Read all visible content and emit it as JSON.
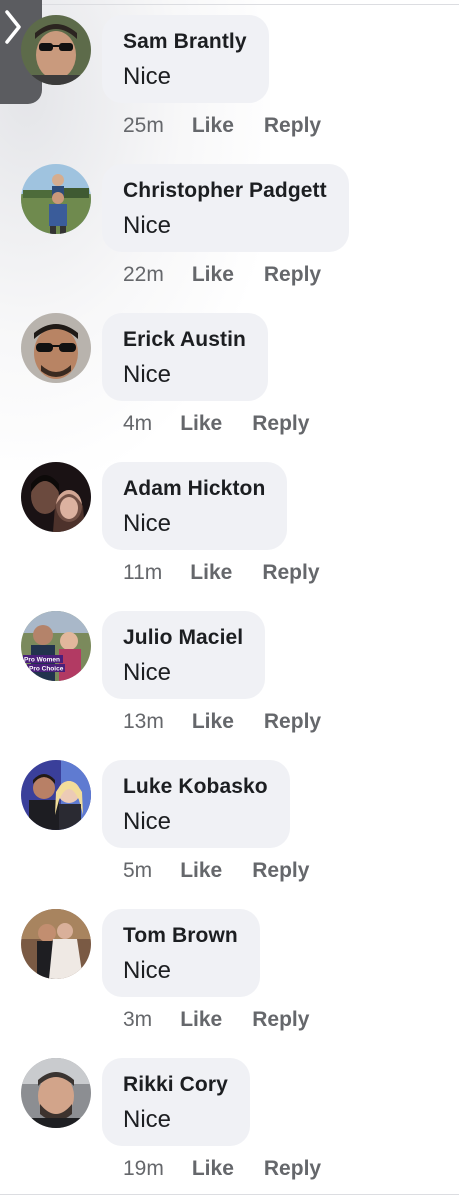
{
  "comments": [
    {
      "author": "Sam Brantly",
      "text": "Nice",
      "time": "25m",
      "like_label": "Like",
      "reply_label": "Reply"
    },
    {
      "author": "Christopher Padgett",
      "text": "Nice",
      "time": "22m",
      "like_label": "Like",
      "reply_label": "Reply"
    },
    {
      "author": "Erick Austin",
      "text": "Nice",
      "time": "4m",
      "like_label": "Like",
      "reply_label": "Reply"
    },
    {
      "author": "Adam Hickton",
      "text": "Nice",
      "time": "11m",
      "like_label": "Like",
      "reply_label": "Reply"
    },
    {
      "author": "Julio Maciel",
      "text": "Nice",
      "time": "13m",
      "like_label": "Like",
      "reply_label": "Reply",
      "avatar_text": [
        "Pro Women",
        "Pro Choice"
      ]
    },
    {
      "author": "Luke Kobasko",
      "text": "Nice",
      "time": "5m",
      "like_label": "Like",
      "reply_label": "Reply"
    },
    {
      "author": "Tom Brown",
      "text": "Nice",
      "time": "3m",
      "like_label": "Like",
      "reply_label": "Reply"
    },
    {
      "author": "Rikki Cory",
      "text": "Nice",
      "time": "19m",
      "like_label": "Like",
      "reply_label": "Reply"
    }
  ],
  "colors": {
    "bubble": "#f0f1f5",
    "text": "#1c1e21",
    "meta": "#65676b",
    "back_tab": "#5b5c60"
  },
  "icons": {
    "back": "chevron-right-icon"
  }
}
